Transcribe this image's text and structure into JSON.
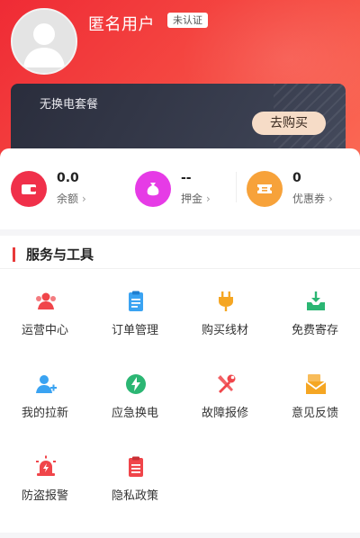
{
  "profile": {
    "username": "匿名用户",
    "verify_status": "未认证"
  },
  "package_card": {
    "title": "无换电套餐",
    "buy_label": "去购买"
  },
  "stats": [
    {
      "value": "0.0",
      "label": "余额",
      "color": "#f0304a",
      "icon": "wallet-icon"
    },
    {
      "value": "--",
      "label": "押金",
      "color": "#e63be6",
      "icon": "money-bag-icon"
    },
    {
      "value": "0",
      "label": "优惠券",
      "color": "#f7a23a",
      "icon": "coupon-icon"
    }
  ],
  "tools": {
    "title": "服务与工具",
    "items": [
      {
        "label": "运营中心",
        "icon": "users-icon",
        "color": "#f0454a"
      },
      {
        "label": "订单管理",
        "icon": "clipboard-icon",
        "color": "#3aa3f2"
      },
      {
        "label": "购买线材",
        "icon": "plug-icon",
        "color": "#f5a623"
      },
      {
        "label": "免费寄存",
        "icon": "tray-download-icon",
        "color": "#2bb673"
      },
      {
        "label": "我的拉新",
        "icon": "add-user-icon",
        "color": "#3aa3f2"
      },
      {
        "label": "应急换电",
        "icon": "lightning-icon",
        "color": "#2bb673"
      },
      {
        "label": "故障报修",
        "icon": "tools-icon",
        "color": "#f0454a"
      },
      {
        "label": "意见反馈",
        "icon": "feedback-envelope-icon",
        "color": "#f5a623"
      },
      {
        "label": "防盗报警",
        "icon": "alarm-icon",
        "color": "#f0454a"
      },
      {
        "label": "隐私政策",
        "icon": "document-icon",
        "color": "#f0454a"
      }
    ]
  }
}
